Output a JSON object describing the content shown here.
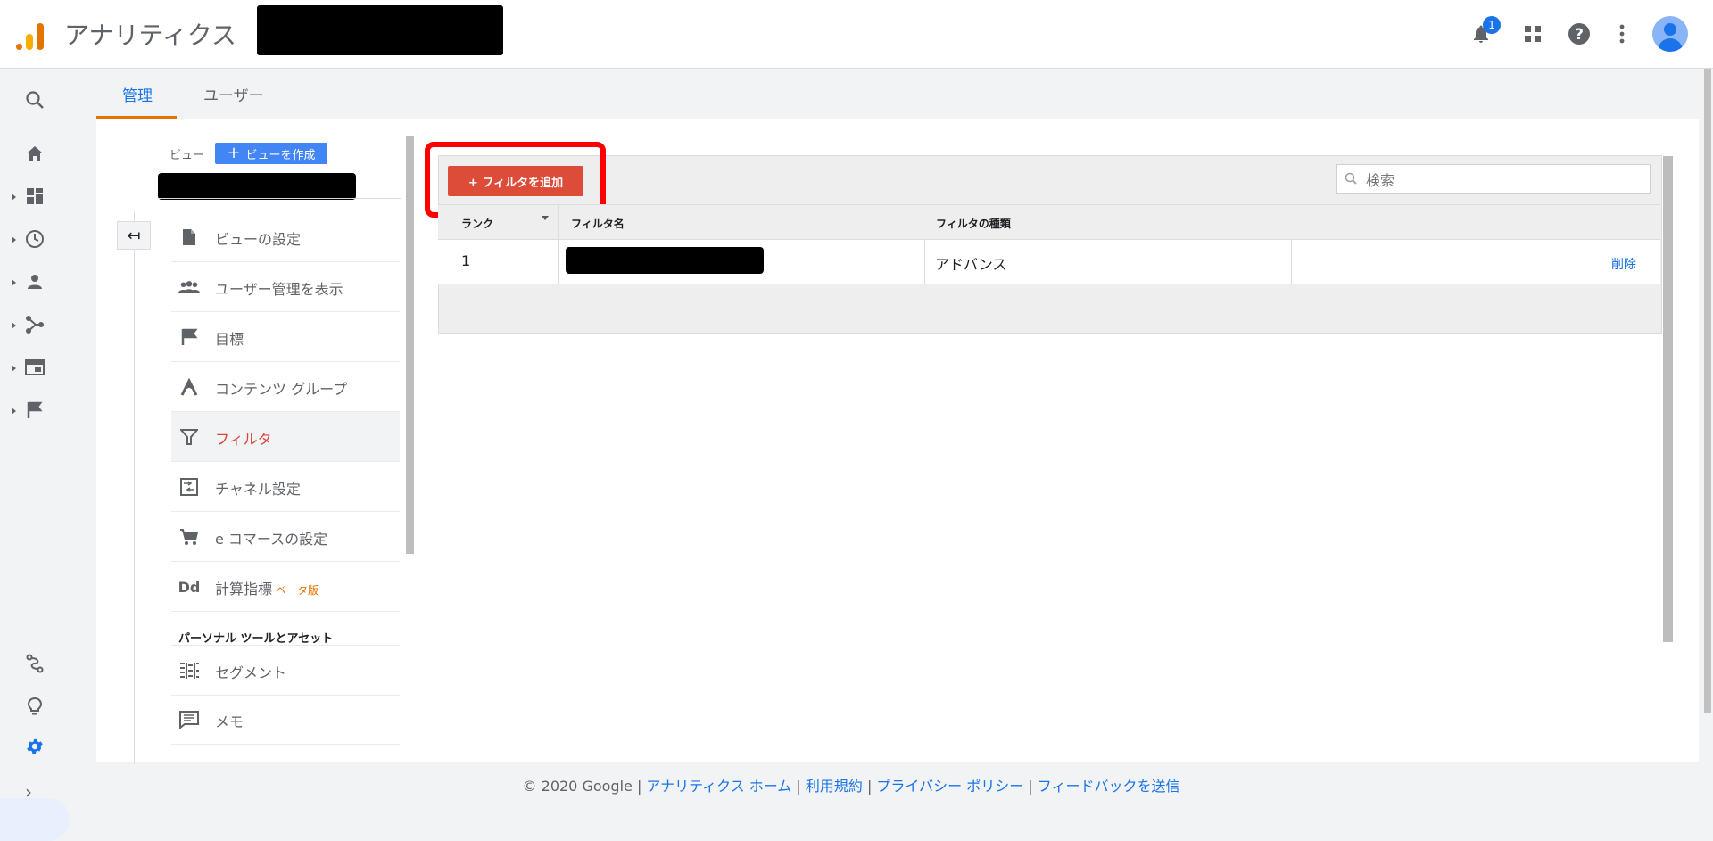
{
  "header": {
    "app_title": "アナリティクス",
    "notification_count": "1"
  },
  "icons": {
    "bell": "bell-icon",
    "apps": "apps-grid-icon",
    "help": "help-icon",
    "more": "more-vert-icon",
    "account": "account-avatar-icon"
  },
  "leftnav": {
    "items": [
      "search",
      "home",
      "customization",
      "realtime",
      "audience",
      "acquisition",
      "behavior",
      "conversions"
    ],
    "bottom": [
      "attribution",
      "discover",
      "admin"
    ]
  },
  "tabs": [
    {
      "label": "管理",
      "active": true
    },
    {
      "label": "ユーザー",
      "active": false
    }
  ],
  "view": {
    "label": "ビュー",
    "create_button": "ビューを作成"
  },
  "menu": {
    "items": [
      {
        "label": "ビューの設定",
        "icon": "document-icon"
      },
      {
        "label": "ユーザー管理を表示",
        "icon": "people-icon"
      },
      {
        "label": "目標",
        "icon": "flag-icon"
      },
      {
        "label": "コンテンツ グループ",
        "icon": "content-group-icon"
      },
      {
        "label": "フィルタ",
        "icon": "filter-icon",
        "active": true
      },
      {
        "label": "チャネル設定",
        "icon": "channel-icon"
      },
      {
        "label": "e コマースの設定",
        "icon": "cart-icon"
      },
      {
        "label": "計算指標",
        "icon": "dd-icon",
        "badge": "ベータ版"
      }
    ],
    "section_title": "パーソナル ツールとアセット",
    "personal_items": [
      {
        "label": "セグメント",
        "icon": "segment-icon"
      },
      {
        "label": "メモ",
        "icon": "note-icon"
      }
    ]
  },
  "filters": {
    "add_button": "+ フィルタを追加",
    "search_placeholder": "検索",
    "columns": [
      "ランク",
      "フィルタ名",
      "フィルタの種類"
    ],
    "rows": [
      {
        "rank": "1",
        "type": "アドバンス",
        "action": "削除"
      }
    ]
  },
  "footer": {
    "copyright": "© 2020 Google | ",
    "links": [
      "アナリティクス ホーム",
      "利用規約",
      "プライバシー ポリシー",
      "フィードバックを送信"
    ],
    "separator": " | "
  },
  "colors": {
    "accent_blue": "#1a73e8",
    "active_red": "#db4437",
    "add_button_red": "#dd4b39",
    "highlight_red": "#ff0000",
    "tab_underline": "#e37400"
  }
}
